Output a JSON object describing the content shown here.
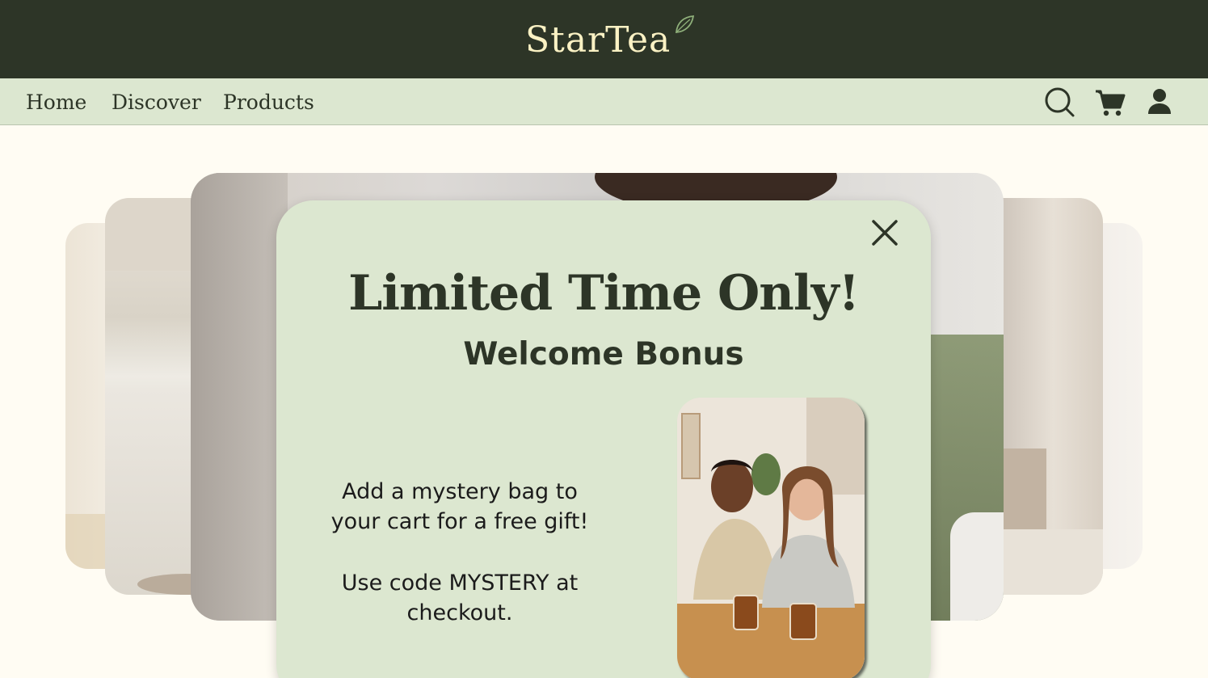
{
  "header": {
    "logo_text": "StarTea",
    "colors": {
      "header_bg": "#2d3527",
      "logo": "#fbf2c4",
      "nav_bg": "#dce7d0",
      "page_bg": "#fffcf3"
    }
  },
  "nav": {
    "items": [
      {
        "label": "Home"
      },
      {
        "label": "Discover"
      },
      {
        "label": "Products"
      }
    ],
    "icons": [
      "search-icon",
      "cart-icon",
      "account-icon"
    ]
  },
  "popup": {
    "title": "Limited Time Only!",
    "subtitle": "Welcome Bonus",
    "body_line_1": "Add a mystery bag to your cart for a free gift!",
    "body_line_2": "Use code MYSTERY at checkout.",
    "close_icon": "close-icon",
    "image": "photo of a couple laughing with cups of tea"
  }
}
